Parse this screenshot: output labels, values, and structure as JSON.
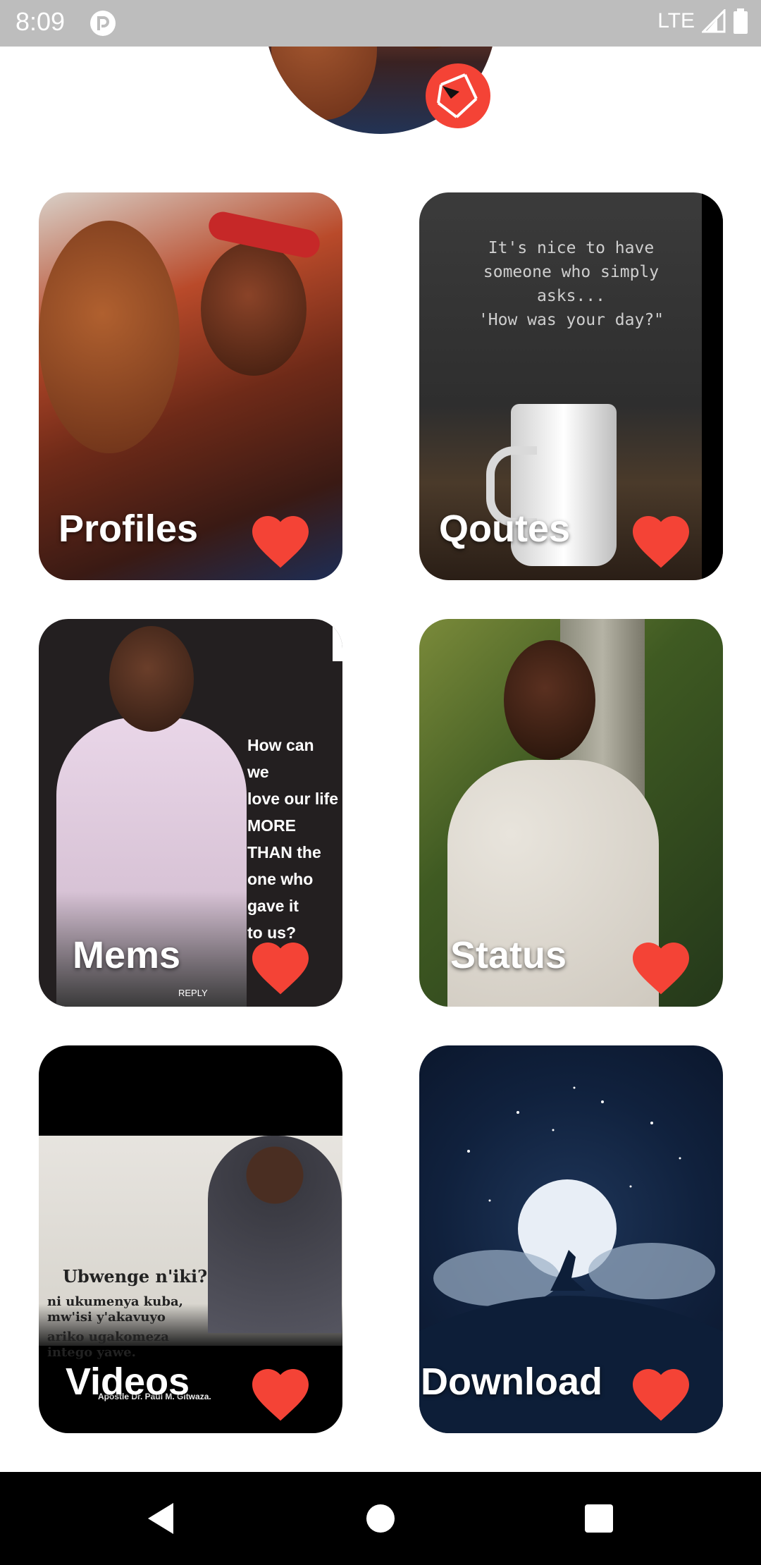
{
  "status_bar": {
    "time": "8:09",
    "network": "LTE",
    "icons": [
      "app-notification-icon",
      "signal-icon",
      "battery-icon"
    ]
  },
  "header": {
    "avatar_icon": "profile-avatar",
    "badge_icon": "camera-shutter-icon",
    "badge_color": "#F44336"
  },
  "cards": [
    {
      "label": "Profiles",
      "icon": "heart-icon"
    },
    {
      "label": "Qoutes",
      "icon": "heart-icon"
    },
    {
      "label": "Mems",
      "icon": "heart-icon"
    },
    {
      "label": "Status",
      "icon": "heart-icon"
    },
    {
      "label": "Videos",
      "icon": "heart-icon"
    },
    {
      "label": "Download",
      "icon": "heart-icon"
    }
  ],
  "card_images": {
    "quote_lines": [
      "It's nice to have",
      "someone who simply",
      "asks...",
      "'How was your day?\""
    ],
    "meme_lines": [
      "How can we",
      "love our life",
      "MORE THAN the",
      "one who gave it",
      "to us?"
    ],
    "meme_reply": "REPLY",
    "promo_title": "Ubwenge n'iki?",
    "promo_lines": [
      "ni ukumenya kuba,",
      "mw'isi y'akavuyo",
      "ariko ugakomeza",
      "intego yawe."
    ],
    "promo_name": "Apostle Dr. Paul M. Gitwaza."
  },
  "accent_color": "#F44336",
  "nav_bar": {
    "icons": [
      "back-icon",
      "home-icon",
      "recents-icon"
    ]
  }
}
